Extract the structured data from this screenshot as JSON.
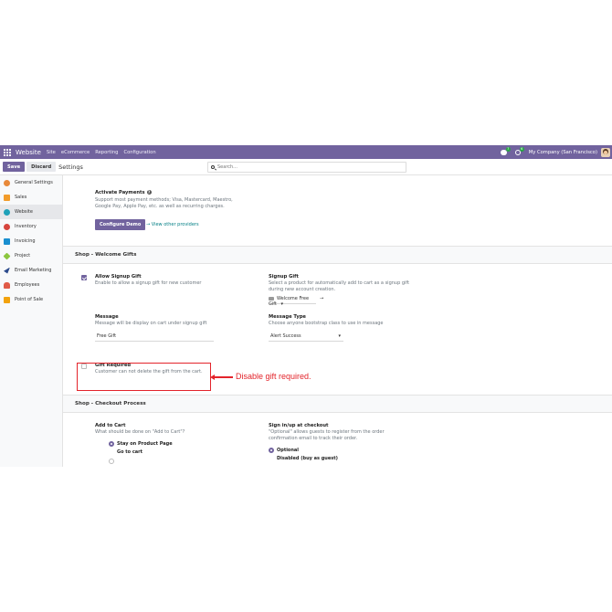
{
  "navbar": {
    "brand": "Website",
    "menus": [
      "Site",
      "eCommerce",
      "Reporting",
      "Configuration"
    ],
    "chat_badge": "7",
    "activity_badge": "6",
    "company": "My Company (San Francisco)"
  },
  "control": {
    "save_label": "Save",
    "discard_label": "Discard",
    "title": "Settings",
    "search_placeholder": "Search..."
  },
  "sidebar": {
    "items": [
      {
        "label": "General Settings",
        "color": "#e8893a"
      },
      {
        "label": "Sales",
        "color": "#f29c2b"
      },
      {
        "label": "Website",
        "color": "#1fa1b8"
      },
      {
        "label": "Inventory",
        "color": "#d6453d"
      },
      {
        "label": "Invoicing",
        "color": "#1a8fd0"
      },
      {
        "label": "Project",
        "color": "#8cc63f"
      },
      {
        "label": "Email Marketing",
        "color": "#2b4a8c"
      },
      {
        "label": "Employees",
        "color": "#e05a47"
      },
      {
        "label": "Point of Sale",
        "color": "#f2a20c"
      }
    ]
  },
  "payments": {
    "title": "Activate Payments",
    "desc1": "Support most payment methods; Visa, Mastercard, Maestro,",
    "desc2": "Google Pay, Apple Pay, etc. as well as recurring charges.",
    "configure_label": "Configure Demo",
    "providers_link": "→ View other providers"
  },
  "welcome": {
    "heading": "Shop - Welcome Gifts",
    "allow_title": "Allow Signup Gift",
    "allow_desc": "Enable to allow a signup gift for new customer",
    "signup_title": "Signup Gift",
    "signup_desc1": "Select a product for automatically add to cart as a signup gift",
    "signup_desc2": "during new account creation.",
    "signup_value": "Welcome Free Gift",
    "message_title": "Message",
    "message_desc": "Message will be display on cart under signup gift",
    "message_value": "Free Gift",
    "type_title": "Message Type",
    "type_desc": "Choose anyone bootstrap class to use in message",
    "type_value": "Alert Success",
    "required_title": "Gift Required",
    "required_desc": "Customer can not delete the gift from the cart."
  },
  "checkout": {
    "heading": "Shop - Checkout Process",
    "add_title": "Add to Cart",
    "add_desc": "What should be done on \"Add to Cart\"?",
    "opt_stay": "Stay on Product Page",
    "opt_go": "Go to cart",
    "sign_title": "Sign in/up at checkout",
    "sign_desc1": "\"Optional\" allows guests to register from the order",
    "sign_desc2": "confirmation email to track their order.",
    "opt_optional": "Optional",
    "opt_disabled": "Disabled (buy as guest)"
  },
  "annotation": {
    "text": "Disable gift required."
  }
}
